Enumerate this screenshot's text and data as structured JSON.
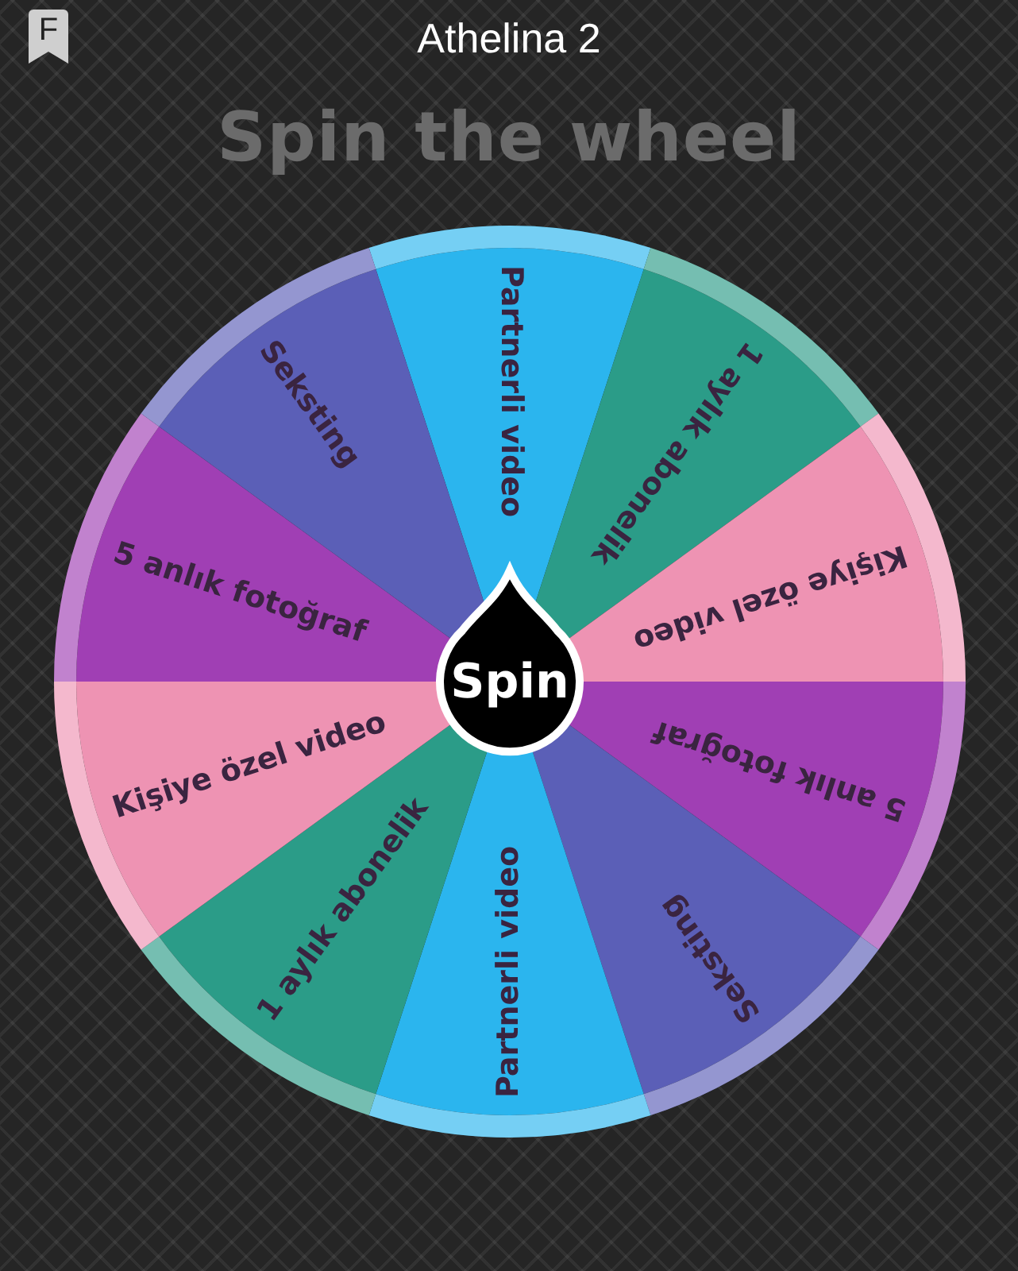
{
  "app_bar": {
    "logo_letter": "F",
    "title": "Athelina 2"
  },
  "heading": "Spin the wheel",
  "wheel": {
    "button": "Spin",
    "segments": [
      {
        "label": "Partnerli video",
        "color": "#2bb5ee"
      },
      {
        "label": "1 aylık abonelik",
        "color": "#2b9c88"
      },
      {
        "label": "Kişiye özel video",
        "color": "#ee93b3"
      },
      {
        "label": "5 anlık fotoğraf",
        "color": "#a03fb4"
      },
      {
        "label": "Seksting",
        "color": "#5b5fb7"
      },
      {
        "label": "Partnerli video",
        "color": "#2bb5ee"
      },
      {
        "label": "1 aylık abonelik",
        "color": "#2b9c88"
      },
      {
        "label": "Kişiye özel video",
        "color": "#ee93b3"
      },
      {
        "label": "5 anlık fotoğraf",
        "color": "#a03fb4"
      },
      {
        "label": "Seksting",
        "color": "#5b5fb7"
      }
    ]
  }
}
